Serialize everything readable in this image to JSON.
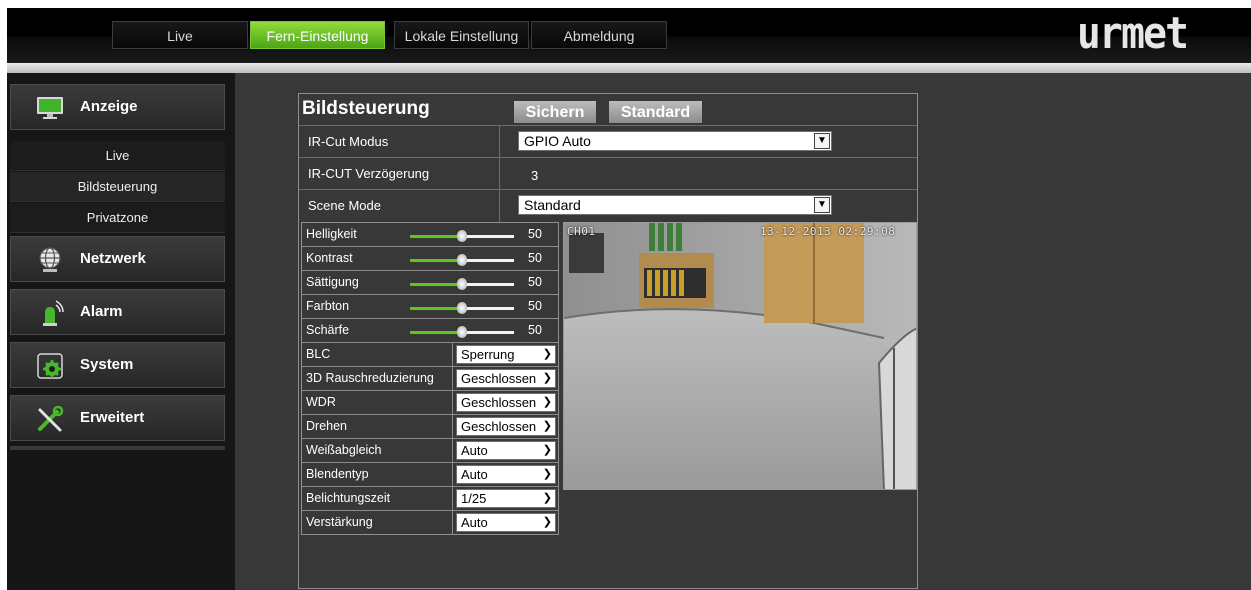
{
  "nav": {
    "tabs": [
      {
        "label": "Live",
        "active": false
      },
      {
        "label": "Fern-Einstellung",
        "active": true
      },
      {
        "label": "Lokale Einstellung",
        "active": false
      },
      {
        "label": "Abmeldung",
        "active": false
      }
    ],
    "logo": "urmet"
  },
  "sidebar": {
    "sections": [
      {
        "label": "Anzeige",
        "icon": "monitor-icon",
        "items": [
          "Live",
          "Bildsteuerung",
          "Privatzone"
        ]
      },
      {
        "label": "Netzwerk",
        "icon": "globe-icon"
      },
      {
        "label": "Alarm",
        "icon": "siren-icon"
      },
      {
        "label": "System",
        "icon": "gear-icon"
      },
      {
        "label": "Erweitert",
        "icon": "tools-icon"
      }
    ]
  },
  "panel": {
    "title": "Bildsteuerung",
    "save_label": "Sichern",
    "default_label": "Standard",
    "settings": [
      {
        "label": "IR-Cut Modus",
        "value": "GPIO Auto",
        "type": "select"
      },
      {
        "label": "IR-CUT Verzögerung",
        "value": "3",
        "type": "text"
      },
      {
        "label": "Scene Mode",
        "value": "Standard",
        "type": "select"
      }
    ],
    "sliders": [
      {
        "label": "Helligkeit",
        "value": 50,
        "max": 100
      },
      {
        "label": "Kontrast",
        "value": 50,
        "max": 100
      },
      {
        "label": "Sättigung",
        "value": 50,
        "max": 100
      },
      {
        "label": "Farbton",
        "value": 50,
        "max": 100
      },
      {
        "label": "Schärfe",
        "value": 50,
        "max": 100
      }
    ],
    "selects": [
      {
        "label": "BLC",
        "value": "Sperrung"
      },
      {
        "label": "3D Rauschreduzierung",
        "value": "Geschlossen"
      },
      {
        "label": "WDR",
        "value": "Geschlossen"
      },
      {
        "label": "Drehen",
        "value": "Geschlossen"
      },
      {
        "label": "Weißabgleich",
        "value": "Auto"
      },
      {
        "label": "Blendentyp",
        "value": "Auto"
      },
      {
        "label": "Belichtungszeit",
        "value": "1/25"
      },
      {
        "label": "Verstärkung",
        "value": "Auto"
      }
    ]
  },
  "video": {
    "channel": "CH01",
    "timestamp": "13-12-2013 02:29:08"
  },
  "colors": {
    "accent": "#5cc71a",
    "active_tab": "#6cc326"
  }
}
